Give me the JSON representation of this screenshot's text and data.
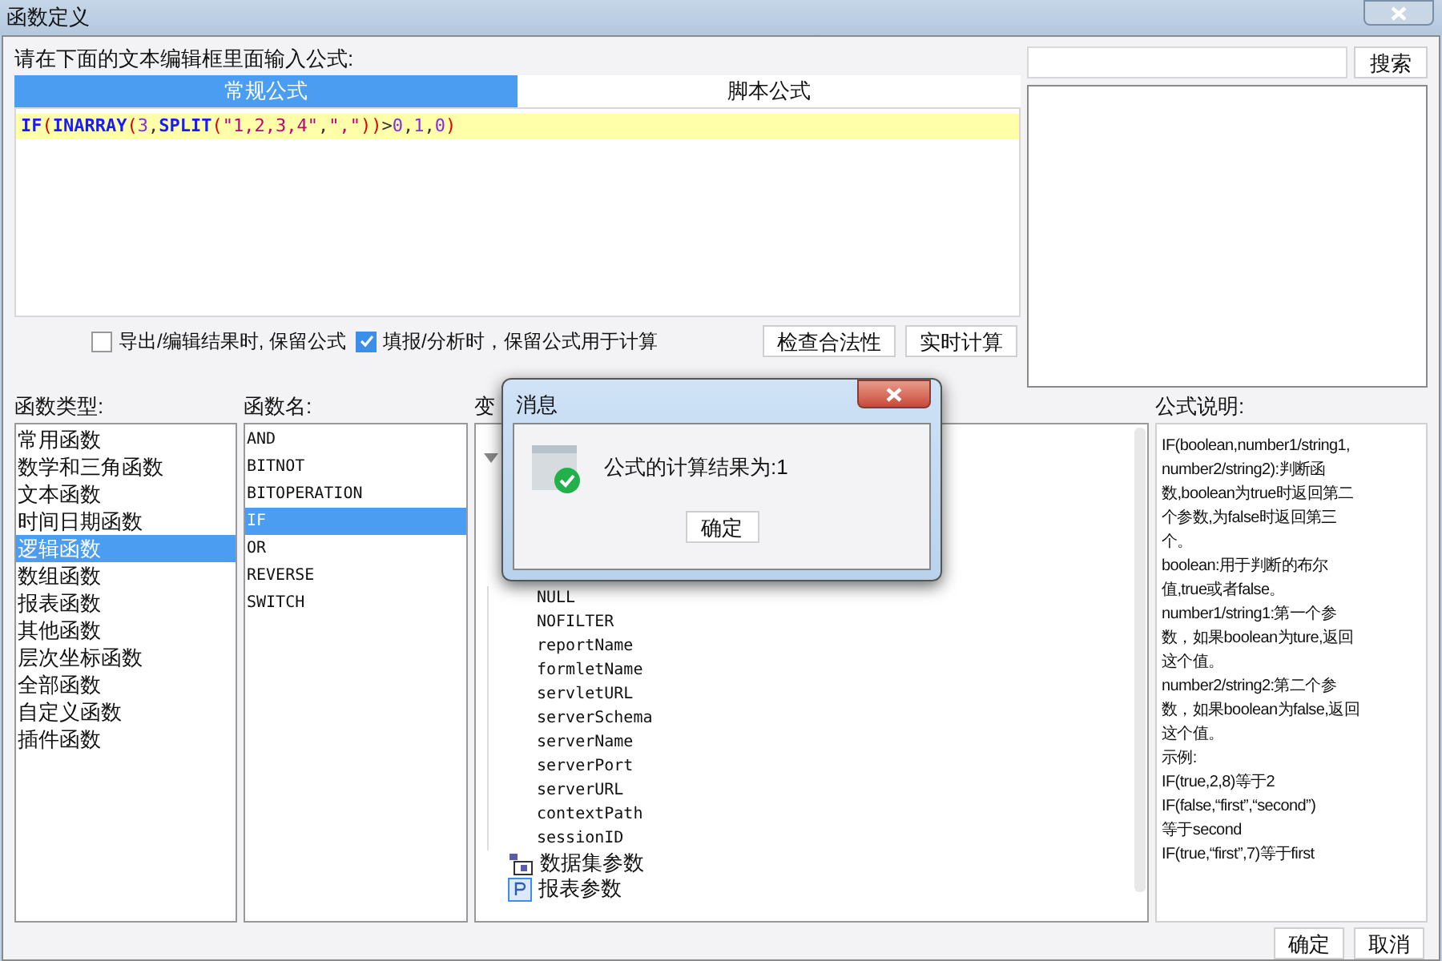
{
  "window": {
    "title": "函数定义"
  },
  "editor": {
    "prompt": "请在下面的文本编辑框里面输入公式:",
    "tabs": [
      {
        "label": "常规公式",
        "selected": true
      },
      {
        "label": "脚本公式",
        "selected": false
      }
    ],
    "formula": [
      {
        "text": "IF",
        "kind": "func"
      },
      {
        "text": "(",
        "kind": "paren"
      },
      {
        "text": "INARRAY",
        "kind": "func"
      },
      {
        "text": "(",
        "kind": "paren"
      },
      {
        "text": "3",
        "kind": "number"
      },
      {
        "text": ",",
        "kind": "punct"
      },
      {
        "text": "SPLIT",
        "kind": "func"
      },
      {
        "text": "(",
        "kind": "paren"
      },
      {
        "text": "\"1,2,3,4\"",
        "kind": "string"
      },
      {
        "text": ",",
        "kind": "punct"
      },
      {
        "text": "\",\"",
        "kind": "string"
      },
      {
        "text": "))",
        "kind": "paren"
      },
      {
        "text": ">",
        "kind": "punct"
      },
      {
        "text": "0",
        "kind": "number"
      },
      {
        "text": ",",
        "kind": "punct"
      },
      {
        "text": "1",
        "kind": "number"
      },
      {
        "text": ",",
        "kind": "punct"
      },
      {
        "text": "0",
        "kind": "number"
      },
      {
        "text": ")",
        "kind": "paren"
      }
    ],
    "options": [
      {
        "label": "导出/编辑结果时, 保留公式",
        "checked": false
      },
      {
        "label": "填报/分析时，保留公式用于计算",
        "checked": true
      }
    ],
    "buttons": [
      "检查合法性",
      "实时计算"
    ]
  },
  "search": {
    "button": "搜索"
  },
  "function_types": {
    "label": "函数类型:",
    "items": [
      {
        "label": "常用函数",
        "selected": false
      },
      {
        "label": "数学和三角函数",
        "selected": false
      },
      {
        "label": "文本函数",
        "selected": false
      },
      {
        "label": "时间日期函数",
        "selected": false
      },
      {
        "label": "逻辑函数",
        "selected": true
      },
      {
        "label": "数组函数",
        "selected": false
      },
      {
        "label": "报表函数",
        "selected": false
      },
      {
        "label": "其他函数",
        "selected": false
      },
      {
        "label": "层次坐标函数",
        "selected": false
      },
      {
        "label": "全部函数",
        "selected": false
      },
      {
        "label": "自定义函数",
        "selected": false
      },
      {
        "label": "插件函数",
        "selected": false
      }
    ]
  },
  "function_names": {
    "label": "函数名:",
    "items": [
      {
        "label": "AND",
        "selected": false
      },
      {
        "label": "BITNOT",
        "selected": false
      },
      {
        "label": "BITOPERATION",
        "selected": false
      },
      {
        "label": "IF",
        "selected": true
      },
      {
        "label": "OR",
        "selected": false
      },
      {
        "label": "REVERSE",
        "selected": false
      },
      {
        "label": "SWITCH",
        "selected": false
      }
    ]
  },
  "variables": {
    "label": "变",
    "leaves": [
      "NULL",
      "NOFILTER",
      "reportName",
      "formletName",
      "servletURL",
      "serverSchema",
      "serverName",
      "serverPort",
      "serverURL",
      "contextPath",
      "sessionID"
    ],
    "groups": [
      {
        "label": "数据集参数",
        "kind": "dataset"
      },
      {
        "label": "报表参数",
        "kind": "param"
      }
    ]
  },
  "description": {
    "label": "公式说明:",
    "lines": [
      "IF(boolean,number1/string1,",
      "number2/string2):判断函",
      "数,boolean为true时返回第二",
      "个参数,为false时返回第三",
      "个。",
      "boolean:用于判断的布尔",
      "值,true或者false。",
      "number1/string1:第一个参",
      "数，如果boolean为ture,返回",
      "这个值。",
      "number2/string2:第二个参",
      "数，如果boolean为false,返回",
      "这个值。",
      "示例:",
      "IF(true,2,8)等于2",
      "IF(false,“first”,“second”)",
      "等于second",
      "IF(true,“first”,7)等于first"
    ]
  },
  "footer": [
    "确定",
    "取消"
  ],
  "message": {
    "title": "消息",
    "text": "公式的计算结果为:1",
    "button": "确定"
  }
}
